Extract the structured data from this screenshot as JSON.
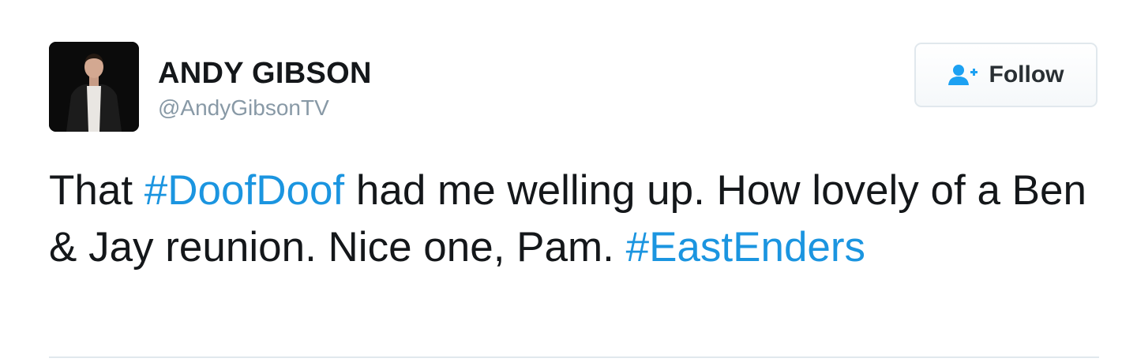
{
  "author": {
    "name": "ANDY GIBSON",
    "handle": "@AndyGibsonTV"
  },
  "follow_button": {
    "label": "Follow",
    "icon": "add-user-icon"
  },
  "tweet": {
    "segments": [
      {
        "text": "That ",
        "type": "text"
      },
      {
        "text": "#DoofDoof",
        "type": "hashtag"
      },
      {
        "text": " had me welling up. How lovely of a Ben & Jay reunion. Nice one, Pam. ",
        "type": "text"
      },
      {
        "text": "#EastEnders",
        "type": "hashtag"
      }
    ]
  },
  "colors": {
    "hashtag": "#1b95e0",
    "text": "#14171a",
    "handle": "#8899a6",
    "follow_icon": "#1da1f2"
  }
}
